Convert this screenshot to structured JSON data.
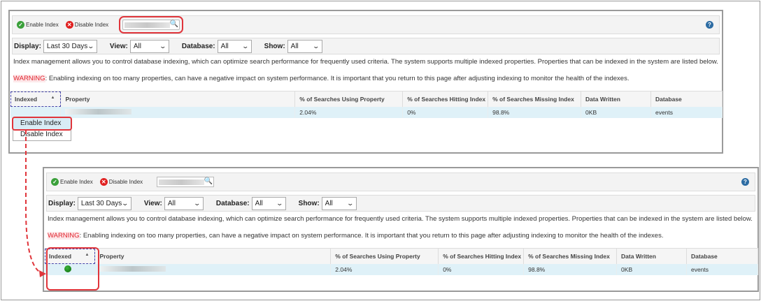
{
  "toolbar": {
    "enable_label": "Enable Index",
    "disable_label": "Disable Index",
    "search_value": "",
    "help_icon": "question-circle-icon"
  },
  "filters": {
    "display_label": "Display:",
    "display_value": "Last 30 Days",
    "view_label": "View:",
    "view_value": "All",
    "database_label": "Database:",
    "database_value": "All",
    "show_label": "Show:",
    "show_value": "All"
  },
  "description": "Index management allows you to control database indexing, which can optimize search performance for frequently used criteria. The system supports multiple indexed properties. Properties that can be indexed in the system are listed below.",
  "warning": {
    "label": "WARNING",
    "text": ": Enabling indexing on too many properties, can have a negative impact on system performance. It is important that you return to this page after adjusting indexing to monitor the health of the indexes."
  },
  "table": {
    "columns": [
      "Indexed",
      "Property",
      "% of Searches Using Property",
      "% of Searches Hitting Index",
      "% of Searches Missing Index",
      "Data Written",
      "Database"
    ],
    "row": {
      "using": "2.04%",
      "hitting": "0%",
      "missing": "98.8%",
      "written": "0KB",
      "database": "events"
    }
  },
  "context_menu": {
    "items": [
      "Enable Index",
      "Disable Index"
    ],
    "selected": "Enable Index"
  },
  "states": {
    "before_indexed": false,
    "after_indexed": true
  },
  "colors": {
    "highlight": "#e0353b",
    "row": "#dff1f8",
    "indexed_dot": "#1a8a1a"
  }
}
